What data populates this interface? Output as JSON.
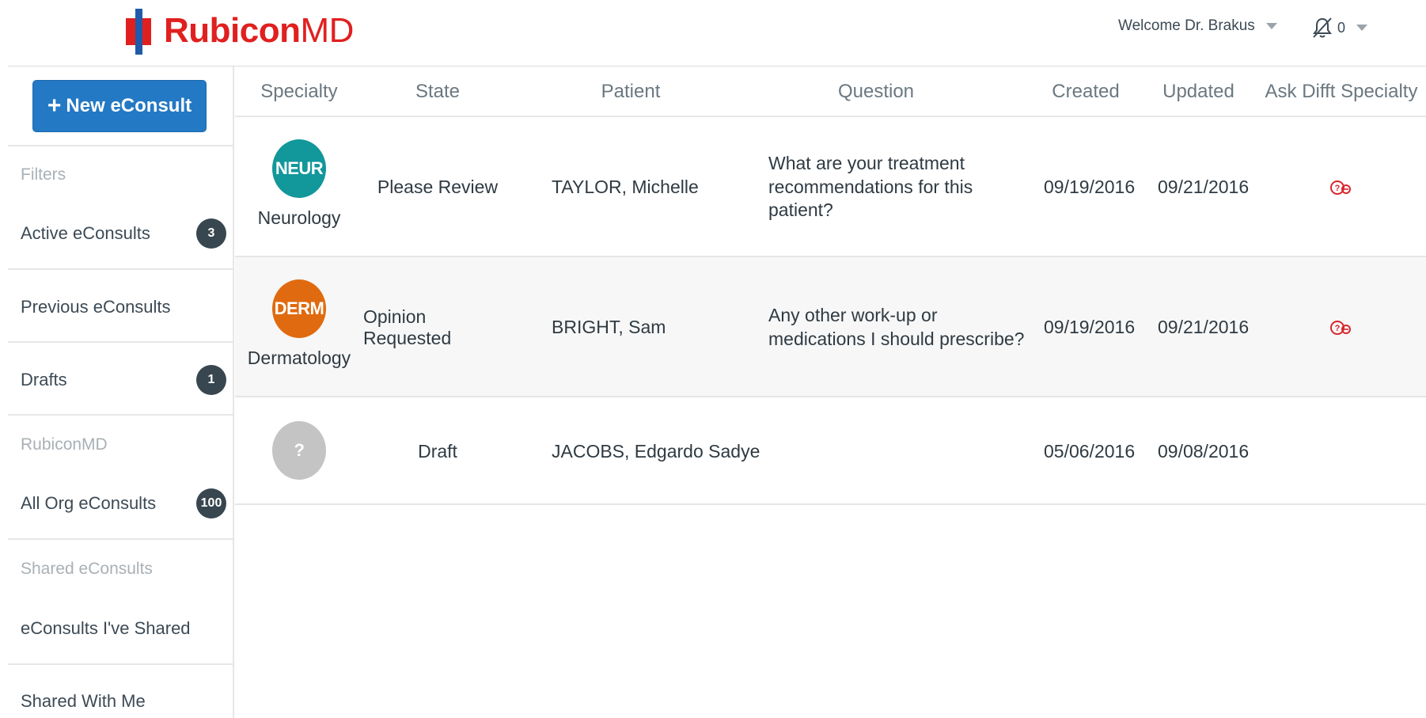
{
  "header": {
    "brand_primary": "Rubicon",
    "brand_secondary": "MD",
    "welcome": "Welcome Dr. Brakus",
    "notification_count": "0",
    "colors": {
      "brand_red": "#e0201f",
      "brand_blue": "#1f5ba8"
    }
  },
  "sidebar": {
    "new_button": {
      "icon": "plus-icon",
      "label": "New eConsult",
      "color": "#2479c4"
    },
    "filters_heading": "Filters",
    "active": {
      "label": "Active eConsults",
      "badge": "3"
    },
    "previous": {
      "label": "Previous eConsults"
    },
    "drafts": {
      "label": "Drafts",
      "badge": "1"
    },
    "org_heading": "RubiconMD",
    "all_org": {
      "label": "All Org eConsults",
      "badge": "100"
    },
    "shared_heading": "Shared eConsults",
    "shared_by_me": {
      "label": "eConsults I've Shared"
    },
    "shared_with_me": {
      "label": "Shared With Me"
    }
  },
  "table": {
    "columns": [
      "Specialty",
      "State",
      "Patient",
      "Question",
      "Created",
      "Updated",
      "Ask Difft Specialty"
    ],
    "rows": [
      {
        "specialty_code": "NEUR",
        "specialty_name": "Neurology",
        "specialty_color": "#12979b",
        "state": "Please Review",
        "patient": "TAYLOR, Michelle",
        "question": "What are your treatment recommendations for this patient?",
        "created": "09/19/2016",
        "updated": "09/21/2016",
        "ask_icon": "ask-different-specialty-icon"
      },
      {
        "specialty_code": "DERM",
        "specialty_name": "Dermatology",
        "specialty_color": "#e06a0f",
        "state": "Opinion Requested",
        "patient": "BRIGHT, Sam",
        "question": "Any other work-up or medications I should prescribe?",
        "created": "09/19/2016",
        "updated": "09/21/2016",
        "ask_icon": "ask-different-specialty-icon"
      },
      {
        "specialty_code": "?",
        "specialty_name": "",
        "specialty_color": "#c4c4c4",
        "state": "Draft",
        "patient": "JACOBS, Edgardo Sadye",
        "question": "",
        "created": "05/06/2016",
        "updated": "09/08/2016",
        "ask_icon": ""
      }
    ]
  }
}
